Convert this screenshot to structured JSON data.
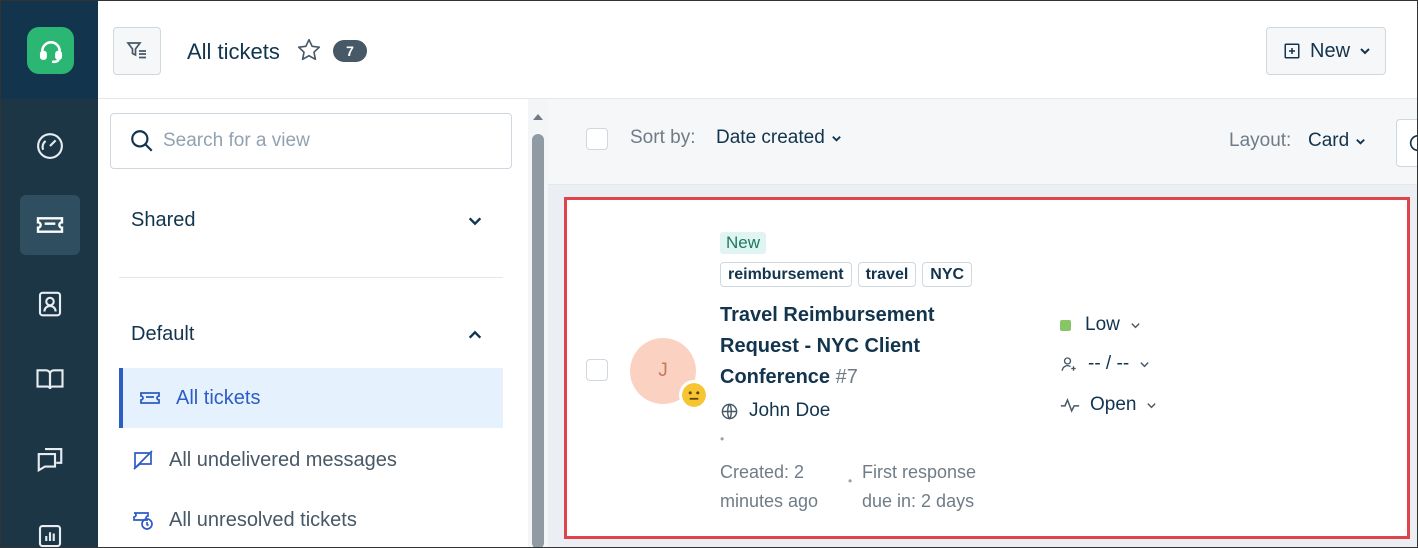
{
  "header": {
    "title": "All tickets",
    "count": "7",
    "new_button": "New"
  },
  "views": {
    "search_placeholder": "Search for a view",
    "shared_label": "Shared",
    "default_label": "Default",
    "items": [
      {
        "label": "All tickets"
      },
      {
        "label": "All undelivered messages"
      },
      {
        "label": "All unresolved tickets"
      }
    ]
  },
  "toolbar": {
    "sort_label": "Sort by:",
    "sort_value": "Date created",
    "layout_label": "Layout:",
    "layout_value": "Card"
  },
  "ticket": {
    "status_pill": "New",
    "tags": [
      "reimbursement",
      "travel",
      "NYC"
    ],
    "subject": "Travel Reimbursement Request - NYC Client Conference",
    "number": "#7",
    "avatar_initial": "J",
    "requester": "John Doe",
    "created": "Created: 2 minutes ago",
    "first_response": "First response due in: 2 days",
    "priority": "Low",
    "assignee": "-- / --",
    "status": "Open"
  },
  "colors": {
    "rail": "#1c3645",
    "accent": "#2c5cc5",
    "logo": "#2bb673",
    "highlight_border": "#e0444b",
    "priority_low": "#88c566"
  }
}
